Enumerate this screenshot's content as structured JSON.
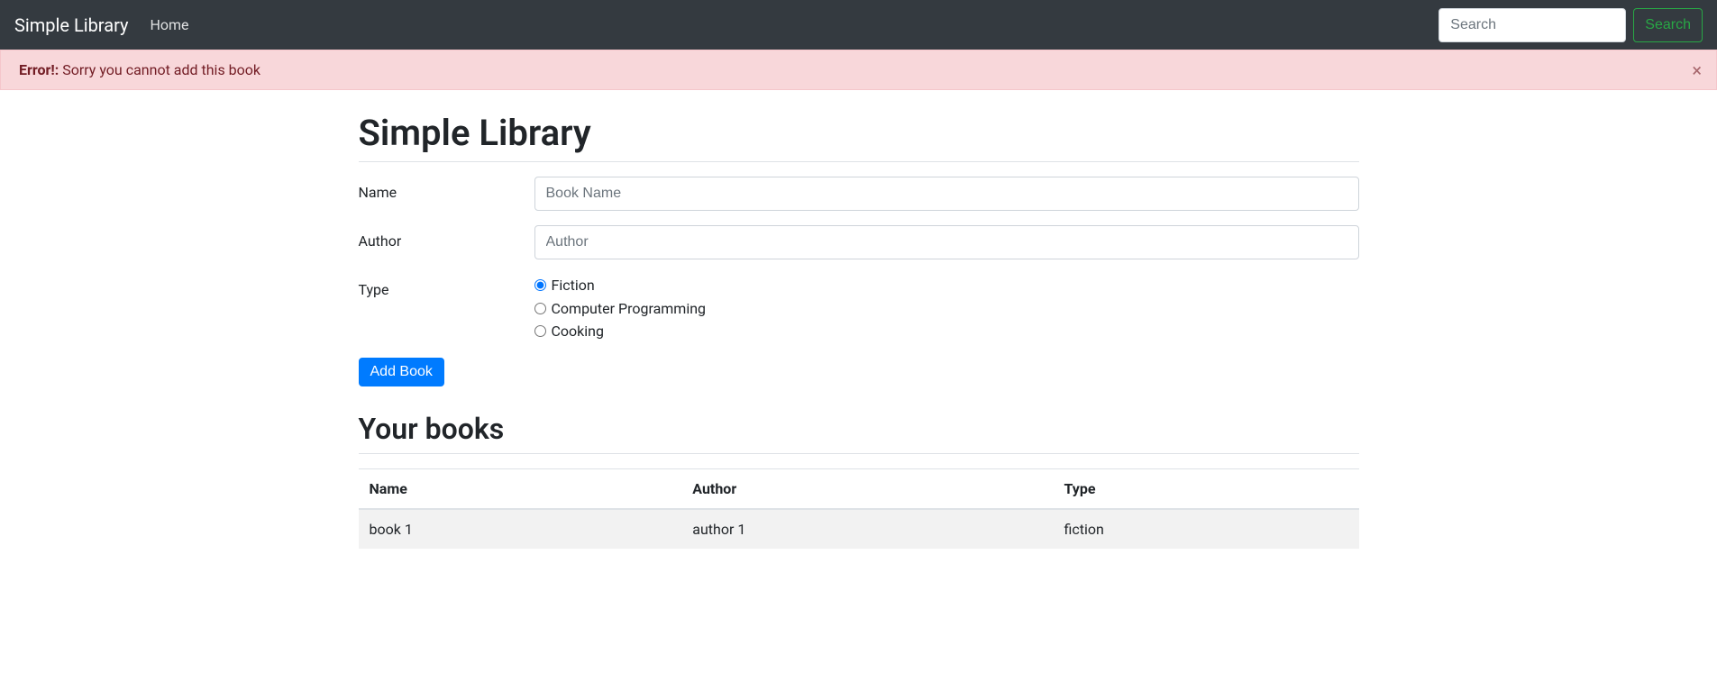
{
  "navbar": {
    "brand": "Simple Library",
    "home_label": "Home",
    "search_placeholder": "Search",
    "search_button_label": "Search"
  },
  "alert": {
    "strong": "Error!:",
    "message": " Sorry you cannot add this book"
  },
  "main": {
    "title": "Simple Library",
    "form": {
      "name_label": "Name",
      "name_placeholder": "Book Name",
      "author_label": "Author",
      "author_placeholder": "Author",
      "type_label": "Type",
      "type_options": [
        {
          "label": "Fiction",
          "checked": true
        },
        {
          "label": "Computer Programming",
          "checked": false
        },
        {
          "label": "Cooking",
          "checked": false
        }
      ],
      "submit_label": "Add Book"
    },
    "books_section": {
      "title": "Your books",
      "columns": [
        "Name",
        "Author",
        "Type"
      ],
      "rows": [
        {
          "name": "book 1",
          "author": "author 1",
          "type": "fiction"
        }
      ]
    }
  }
}
